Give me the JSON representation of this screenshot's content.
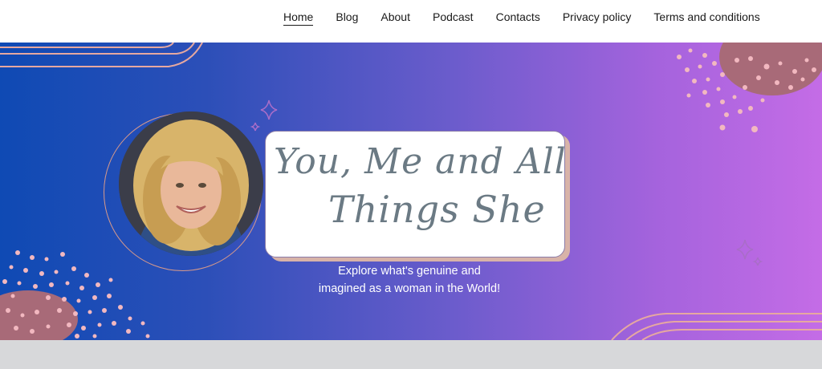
{
  "nav": {
    "items": [
      {
        "label": "Home",
        "active": true
      },
      {
        "label": "Blog"
      },
      {
        "label": "About"
      },
      {
        "label": "Podcast"
      },
      {
        "label": "Contacts"
      },
      {
        "label": "Privacy policy"
      },
      {
        "label": "Terms and conditions"
      }
    ]
  },
  "hero": {
    "title_line1": "You, Me and All",
    "title_line2": "Things She",
    "tagline_line1": "Explore what's genuine and",
    "tagline_line2": "imagined as a woman in the World!",
    "colors": {
      "gradient_start": "#0f4ab4",
      "gradient_end": "#c46ce6",
      "dot_color": "#f2b8c0",
      "blob_color": "#a86a78",
      "title_text": "#6b7a84"
    }
  },
  "portrait": {
    "icon": "woman-portrait-photo"
  }
}
